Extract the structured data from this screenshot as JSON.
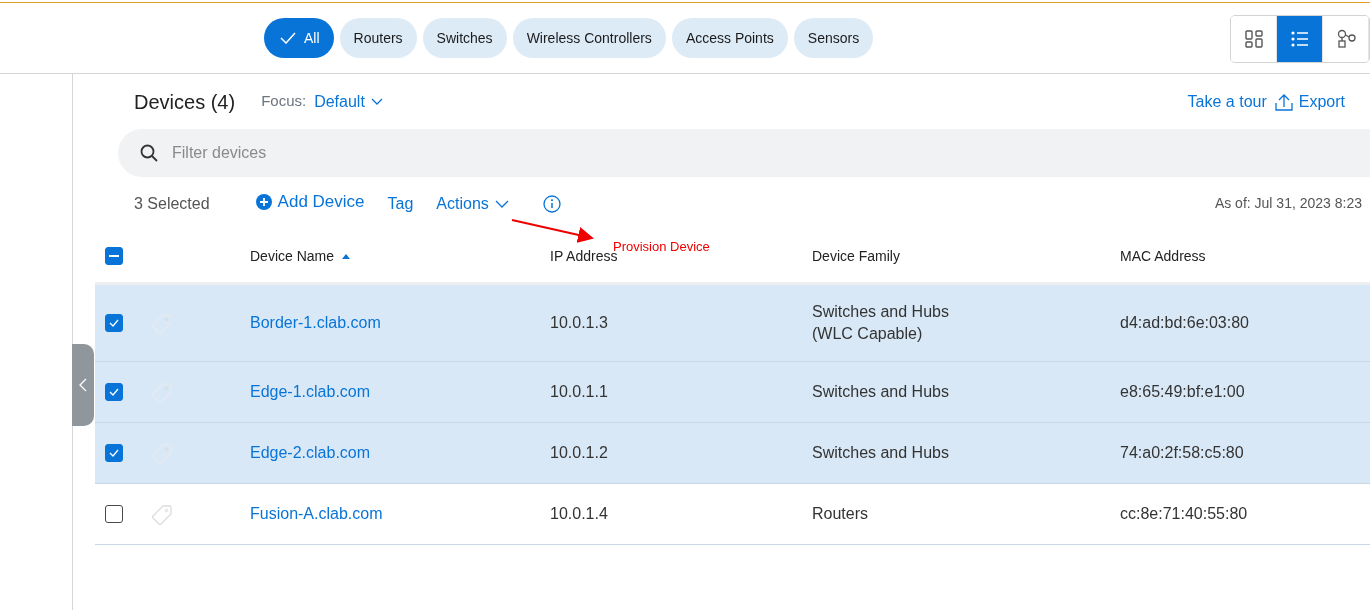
{
  "filters": [
    {
      "label": "All",
      "selected": true
    },
    {
      "label": "Routers",
      "selected": false
    },
    {
      "label": "Switches",
      "selected": false
    },
    {
      "label": "Wireless Controllers",
      "selected": false
    },
    {
      "label": "Access Points",
      "selected": false
    },
    {
      "label": "Sensors",
      "selected": false
    }
  ],
  "view_toggle": [
    {
      "kind": "grid",
      "selected": false
    },
    {
      "kind": "list",
      "selected": true
    },
    {
      "kind": "topology",
      "selected": false
    }
  ],
  "header": {
    "title": "Devices (4)",
    "focus_label": "Focus:",
    "focus_value": "Default",
    "tour_link": "Take a tour",
    "export_link": "Export"
  },
  "search": {
    "placeholder": "Filter devices"
  },
  "toolbar": {
    "selected_count": "3 Selected",
    "add": "Add Device",
    "tag": "Tag",
    "actions": "Actions",
    "as_of": "As of: Jul 31, 2023 8:23"
  },
  "table": {
    "select_all_indeterminate": true,
    "columns": [
      {
        "label": "Device Name",
        "sorted": true
      },
      {
        "label": "IP Address",
        "sorted": false
      },
      {
        "label": "Device Family",
        "sorted": false
      },
      {
        "label": "MAC Address",
        "sorted": false
      }
    ],
    "rows": [
      {
        "selected": true,
        "name": "Border-1.clab.com",
        "ip": "10.0.1.3",
        "family": "Switches and Hubs\n(WLC Capable)",
        "mac": "d4:ad:bd:6e:03:80"
      },
      {
        "selected": true,
        "name": "Edge-1.clab.com",
        "ip": "10.0.1.1",
        "family": "Switches and Hubs",
        "mac": "e8:65:49:bf:e1:00"
      },
      {
        "selected": true,
        "name": "Edge-2.clab.com",
        "ip": "10.0.1.2",
        "family": "Switches and Hubs",
        "mac": "74:a0:2f:58:c5:80"
      },
      {
        "selected": false,
        "name": "Fusion-A.clab.com",
        "ip": "10.0.1.4",
        "family": "Routers",
        "mac": "cc:8e:71:40:55:80"
      }
    ]
  },
  "annotation": {
    "text": "Provision Device"
  }
}
